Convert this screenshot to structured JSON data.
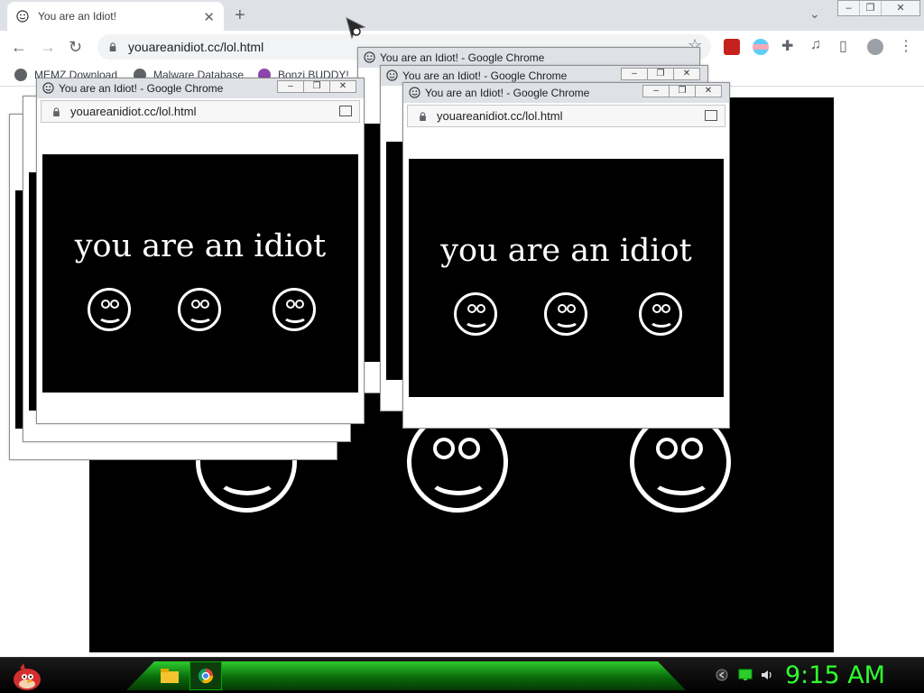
{
  "browser": {
    "tab_title": "You are an Idiot!",
    "new_tab_label": "+",
    "url": "youareanidiot.cc/lol.html",
    "bookmarks": [
      "MEMZ Download",
      "Malware Database",
      "Bonzi BUDDY!"
    ]
  },
  "popups": [
    {
      "title": "You are an Idiot! - Google Chrome",
      "url": "youareanidiot.cc/lol.html",
      "message": "you are an idiot"
    },
    {
      "title": "You are an Idiot! - Google Chrome",
      "url": "youareanidiot.cc/lol.html",
      "message": "you are an idiot"
    },
    {
      "title": "You are an Idiot! - Google Chrome",
      "url": "youareanidiot.cc/lol.html",
      "message": "you are an idiot"
    },
    {
      "title": "You are an Idiot! - Google Chrome",
      "url": "youareanidiot.cc/lol.html",
      "message": "you are an idiot"
    }
  ],
  "taskbar": {
    "clock": "9:15 AM"
  },
  "colors": {
    "accent_green": "#2fff2f",
    "page_background": "#000000",
    "chrome_frame": "#dee1e6"
  },
  "icons": [
    "smiley-icon",
    "lock-icon",
    "back-arrow-icon",
    "forward-arrow-icon",
    "reload-icon",
    "star-icon",
    "extensions-icon",
    "profile-icon",
    "angry-bird-start-icon",
    "folder-icon",
    "chrome-icon",
    "volume-icon",
    "network-icon"
  ]
}
